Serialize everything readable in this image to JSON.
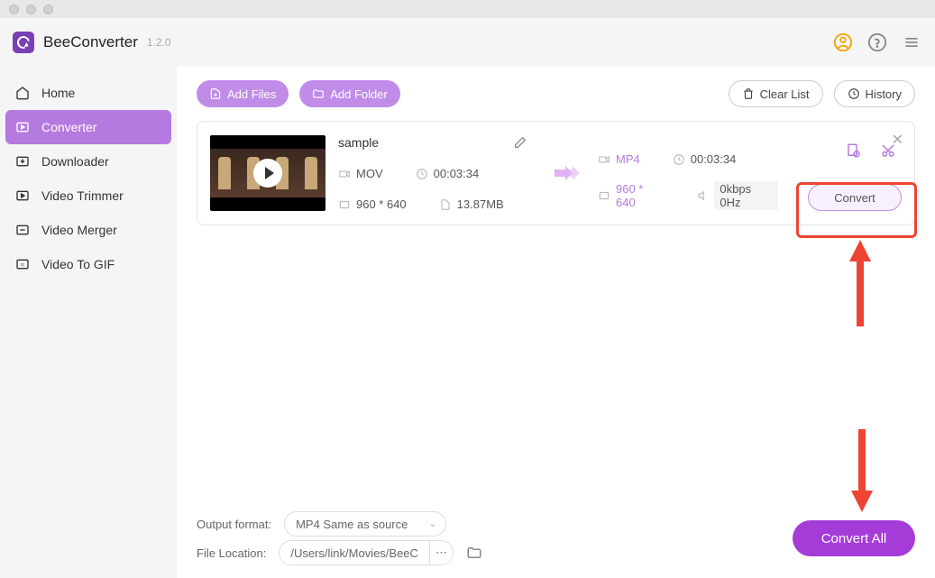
{
  "app": {
    "name": "BeeConverter",
    "version": "1.2.0"
  },
  "sidebar": {
    "items": [
      {
        "label": "Home",
        "icon": "house"
      },
      {
        "label": "Converter",
        "icon": "convert",
        "active": true
      },
      {
        "label": "Downloader",
        "icon": "download"
      },
      {
        "label": "Video Trimmer",
        "icon": "trim"
      },
      {
        "label": "Video Merger",
        "icon": "merge"
      },
      {
        "label": "Video To GIF",
        "icon": "gif"
      }
    ]
  },
  "toolbar": {
    "add_files": "Add Files",
    "add_folder": "Add Folder",
    "clear_list": "Clear List",
    "history": "History"
  },
  "item": {
    "name": "sample",
    "source": {
      "format": "MOV",
      "duration": "00:03:34",
      "resolution": "960 * 640",
      "size": "13.87MB"
    },
    "target": {
      "format": "MP4",
      "duration": "00:03:34",
      "resolution": "960 * 640",
      "audio": "0kbps 0Hz"
    },
    "convert_label": "Convert"
  },
  "bottom": {
    "output_label": "Output format:",
    "output_value": "MP4 Same as source",
    "location_label": "File Location:",
    "location_value": "/Users/link/Movies/BeeC",
    "convert_all": "Convert All"
  }
}
